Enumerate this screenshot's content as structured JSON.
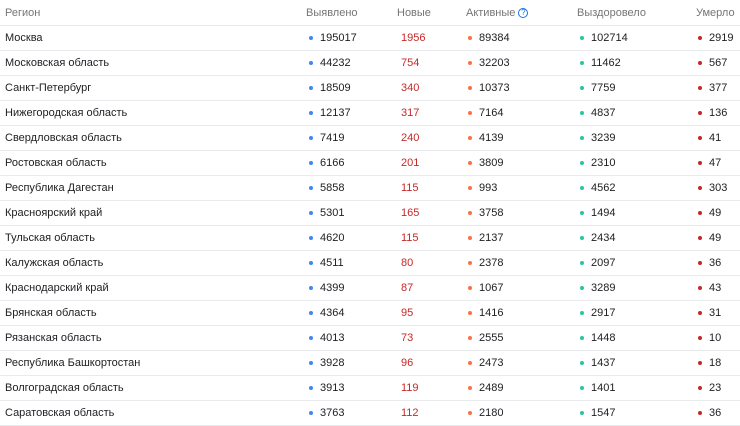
{
  "colors": {
    "confirmed": "#4285f4",
    "active": "#ff7043",
    "recovered": "#26c6a2",
    "deaths": "#c62828",
    "new_text": "#c62828"
  },
  "header": {
    "region": "Регион",
    "confirmed": "Выявлено",
    "new": "Новые",
    "active": "Активные",
    "active_help_icon": "?",
    "recovered": "Выздоровело",
    "deaths": "Умерло"
  },
  "rows": [
    {
      "region": "Москва",
      "confirmed": "195017",
      "new": "1956",
      "active": "89384",
      "recovered": "102714",
      "deaths": "2919"
    },
    {
      "region": "Московская область",
      "confirmed": "44232",
      "new": "754",
      "active": "32203",
      "recovered": "11462",
      "deaths": "567"
    },
    {
      "region": "Санкт-Петербург",
      "confirmed": "18509",
      "new": "340",
      "active": "10373",
      "recovered": "7759",
      "deaths": "377"
    },
    {
      "region": "Нижегородская область",
      "confirmed": "12137",
      "new": "317",
      "active": "7164",
      "recovered": "4837",
      "deaths": "136"
    },
    {
      "region": "Свердловская область",
      "confirmed": "7419",
      "new": "240",
      "active": "4139",
      "recovered": "3239",
      "deaths": "41"
    },
    {
      "region": "Ростовская область",
      "confirmed": "6166",
      "new": "201",
      "active": "3809",
      "recovered": "2310",
      "deaths": "47"
    },
    {
      "region": "Республика Дагестан",
      "confirmed": "5858",
      "new": "115",
      "active": "993",
      "recovered": "4562",
      "deaths": "303"
    },
    {
      "region": "Красноярский край",
      "confirmed": "5301",
      "new": "165",
      "active": "3758",
      "recovered": "1494",
      "deaths": "49"
    },
    {
      "region": "Тульская область",
      "confirmed": "4620",
      "new": "115",
      "active": "2137",
      "recovered": "2434",
      "deaths": "49"
    },
    {
      "region": "Калужская область",
      "confirmed": "4511",
      "new": "80",
      "active": "2378",
      "recovered": "2097",
      "deaths": "36"
    },
    {
      "region": "Краснодарский край",
      "confirmed": "4399",
      "new": "87",
      "active": "1067",
      "recovered": "3289",
      "deaths": "43"
    },
    {
      "region": "Брянская область",
      "confirmed": "4364",
      "new": "95",
      "active": "1416",
      "recovered": "2917",
      "deaths": "31"
    },
    {
      "region": "Рязанская область",
      "confirmed": "4013",
      "new": "73",
      "active": "2555",
      "recovered": "1448",
      "deaths": "10"
    },
    {
      "region": "Республика Башкортостан",
      "confirmed": "3928",
      "new": "96",
      "active": "2473",
      "recovered": "1437",
      "deaths": "18"
    },
    {
      "region": "Волгоградская область",
      "confirmed": "3913",
      "new": "119",
      "active": "2489",
      "recovered": "1401",
      "deaths": "23"
    },
    {
      "region": "Саратовская область",
      "confirmed": "3763",
      "new": "112",
      "active": "2180",
      "recovered": "1547",
      "deaths": "36"
    }
  ]
}
